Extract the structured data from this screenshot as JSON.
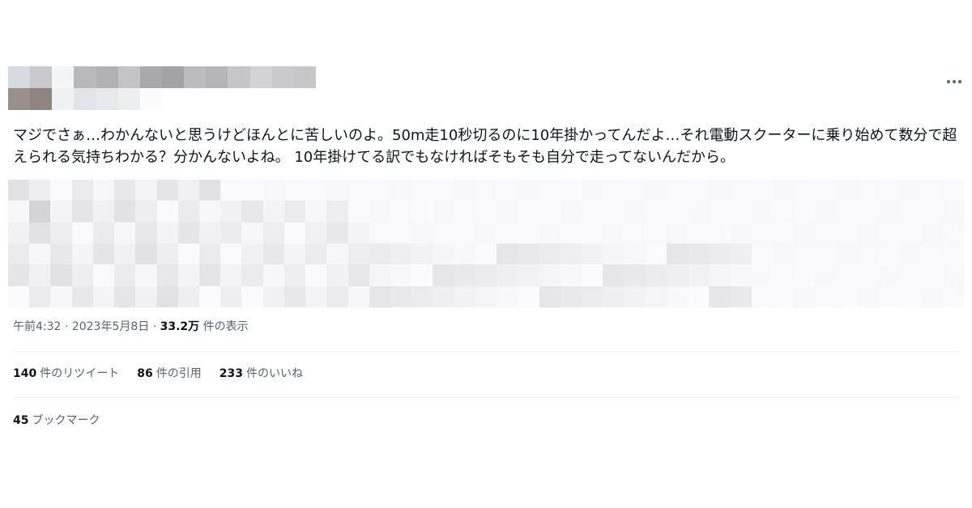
{
  "tweet": {
    "text": "マジでさぁ…わかんないと思うけどほんとに苦しいのよ。50m走10秒切るのに10年掛かってんだよ…それ電動スクーターに乗り始めて数分で超えられる気持ちわかる？分かんないよね。 10年掛けてる訳でもなければそもそも自分で走ってないんだから。",
    "time": "午前4:32",
    "date": "2023年5月8日",
    "separator": "·",
    "views_count": "33.2万",
    "views_label": "件の表示"
  },
  "stats": {
    "retweets_count": "140",
    "retweets_label": "件のリツイート",
    "quotes_count": "86",
    "quotes_label": "件の引用",
    "likes_count": "233",
    "likes_label": "件のいいね",
    "bookmarks_count": "45",
    "bookmarks_label": "ブックマーク"
  },
  "icons": {
    "more": "more-horizontal-icon"
  },
  "colors": {
    "text_primary": "#0f1419",
    "text_secondary": "#536471",
    "divider": "#eff3f4"
  }
}
